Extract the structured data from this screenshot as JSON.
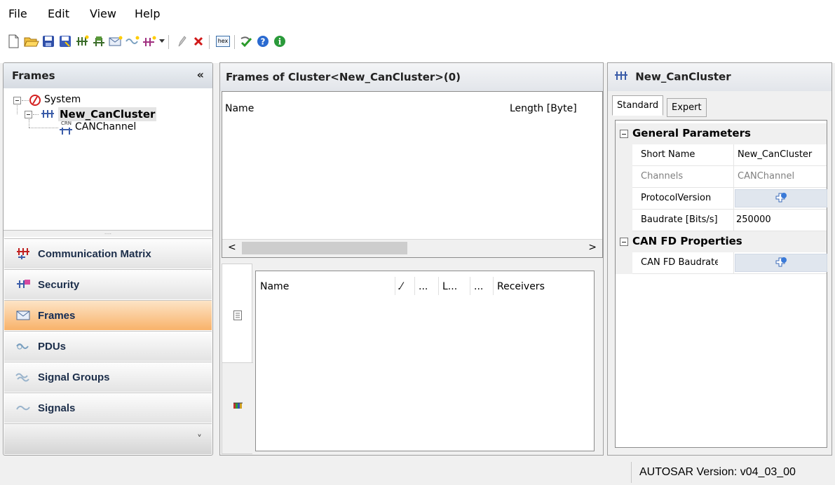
{
  "menu": [
    "File",
    "Edit",
    "View",
    "Help"
  ],
  "toolbar": {
    "hex_label": "hex"
  },
  "left_panel": {
    "title": "Frames",
    "collapse_glyph": "«",
    "tree": {
      "root": "System",
      "cluster": "New_CanCluster",
      "channel": "CANChannel",
      "channel_badge": "CRN"
    },
    "splitter_glyph": "....",
    "nav": [
      {
        "label": "Communication Matrix",
        "icon": "communication-matrix-icon"
      },
      {
        "label": "Security",
        "icon": "security-icon"
      },
      {
        "label": "Frames",
        "icon": "envelope-icon",
        "active": true
      },
      {
        "label": "PDUs",
        "icon": "pdu-icon"
      },
      {
        "label": "Signal Groups",
        "icon": "signal-groups-icon"
      },
      {
        "label": "Signals",
        "icon": "signal-wave-icon"
      }
    ],
    "more_glyph": "˅"
  },
  "middle_panel": {
    "title": "Frames of Cluster<New_CanCluster>(0)",
    "columns": [
      "Name",
      "Length [Byte]"
    ],
    "scroll_left": "<",
    "scroll_right": ">",
    "lower_columns": [
      "Name",
      ".⁄",
      "...",
      "L...",
      "...",
      "Receivers"
    ]
  },
  "right_panel": {
    "title": "New_CanCluster",
    "tabs": [
      "Standard",
      "Expert"
    ],
    "categories": [
      {
        "name": "General Parameters",
        "props": [
          {
            "name": "Short Name",
            "value": "New_CanCluster"
          },
          {
            "name": "Channels",
            "value": "CANChannel",
            "disabled": true
          },
          {
            "name": "ProtocolVersion",
            "value": "",
            "button": true
          },
          {
            "name": "Baudrate [Bits/s]",
            "value": "250000"
          }
        ]
      },
      {
        "name": "CAN FD Properties",
        "props": [
          {
            "name": "CAN FD Baudrate",
            "value": "",
            "button": true
          }
        ]
      }
    ]
  },
  "status": {
    "autosar_version": "AUTOSAR Version: v04_03_00"
  },
  "colors": {
    "active_nav": "#f8b26a",
    "nav_text": "#1c2e4a",
    "header": "#d6dbe2"
  }
}
